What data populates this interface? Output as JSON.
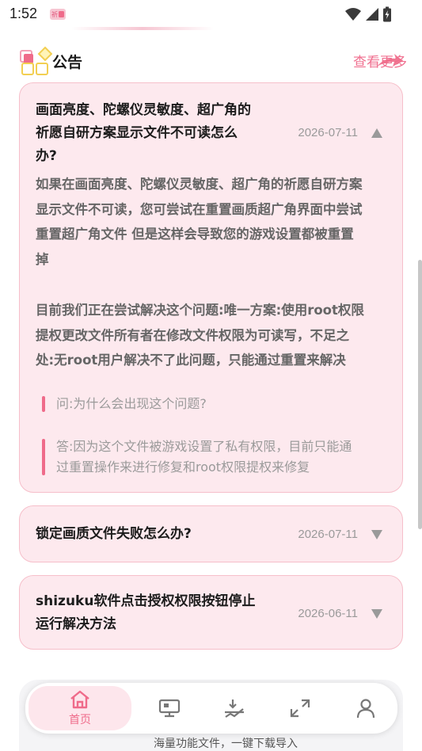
{
  "status_bar": {
    "time": "1:52",
    "icons": [
      "app-notification-icon",
      "wifi-icon",
      "signal-icon",
      "battery-charging-icon"
    ]
  },
  "notice": {
    "title": "公告",
    "more_label": "查看更多",
    "icon": "notice-logo-icon"
  },
  "faqs": [
    {
      "question_lines": [
        "画面亮度、陀螺仪灵敏度、超广角的",
        "祈愿自研方案显示文件不可读怎么",
        "办?"
      ],
      "date": "2026-07-11",
      "expanded": true,
      "body_paragraphs": [
        [
          "如果在画面亮度、陀螺仪灵敏度、超广角的祈愿自研方案",
          "显示文件不可读，您可尝试在重置画质超广角界面中尝试",
          "重置超广角文件 但是这样会导致您的游戏设置都被重置",
          "掉"
        ],
        [
          "目前我们正在尝试解决这个问题:唯一方案:使用root权限",
          "提权更改文件所有者在修改文件权限为可读写，不足之",
          "处:无root用户解决不了此问题，只能通过重置来解决"
        ]
      ],
      "quotes": [
        [
          "问:为什么会出现这个问题?"
        ],
        [
          "答:因为这个文件被游戏设置了私有权限，目前只能通",
          "过重置操作来进行修复和root权限提权来修复"
        ]
      ]
    },
    {
      "question_lines": [
        "锁定画质文件失败怎么办?"
      ],
      "date": "2026-07-11",
      "expanded": false
    },
    {
      "question_lines": [
        "shizuku软件点击授权权限按钮停止",
        "运行解决方法"
      ],
      "date": "2026-06-11",
      "expanded": false
    }
  ],
  "tabbar": {
    "tabs": [
      {
        "label": "首页",
        "icon": "home-icon",
        "active": true
      },
      {
        "label": "",
        "icon": "monitor-icon",
        "active": false
      },
      {
        "label": "",
        "icon": "download-chart-icon",
        "active": false
      },
      {
        "label": "",
        "icon": "expand-icon",
        "active": false
      },
      {
        "label": "",
        "icon": "user-icon",
        "active": false
      }
    ],
    "below_text": "海量功能文件，一键下载导入"
  },
  "colors": {
    "accent": "#ef6b8a",
    "card_bg": "#fde9ee",
    "card_border": "#f6bfca",
    "muted": "#9a9a9a"
  }
}
